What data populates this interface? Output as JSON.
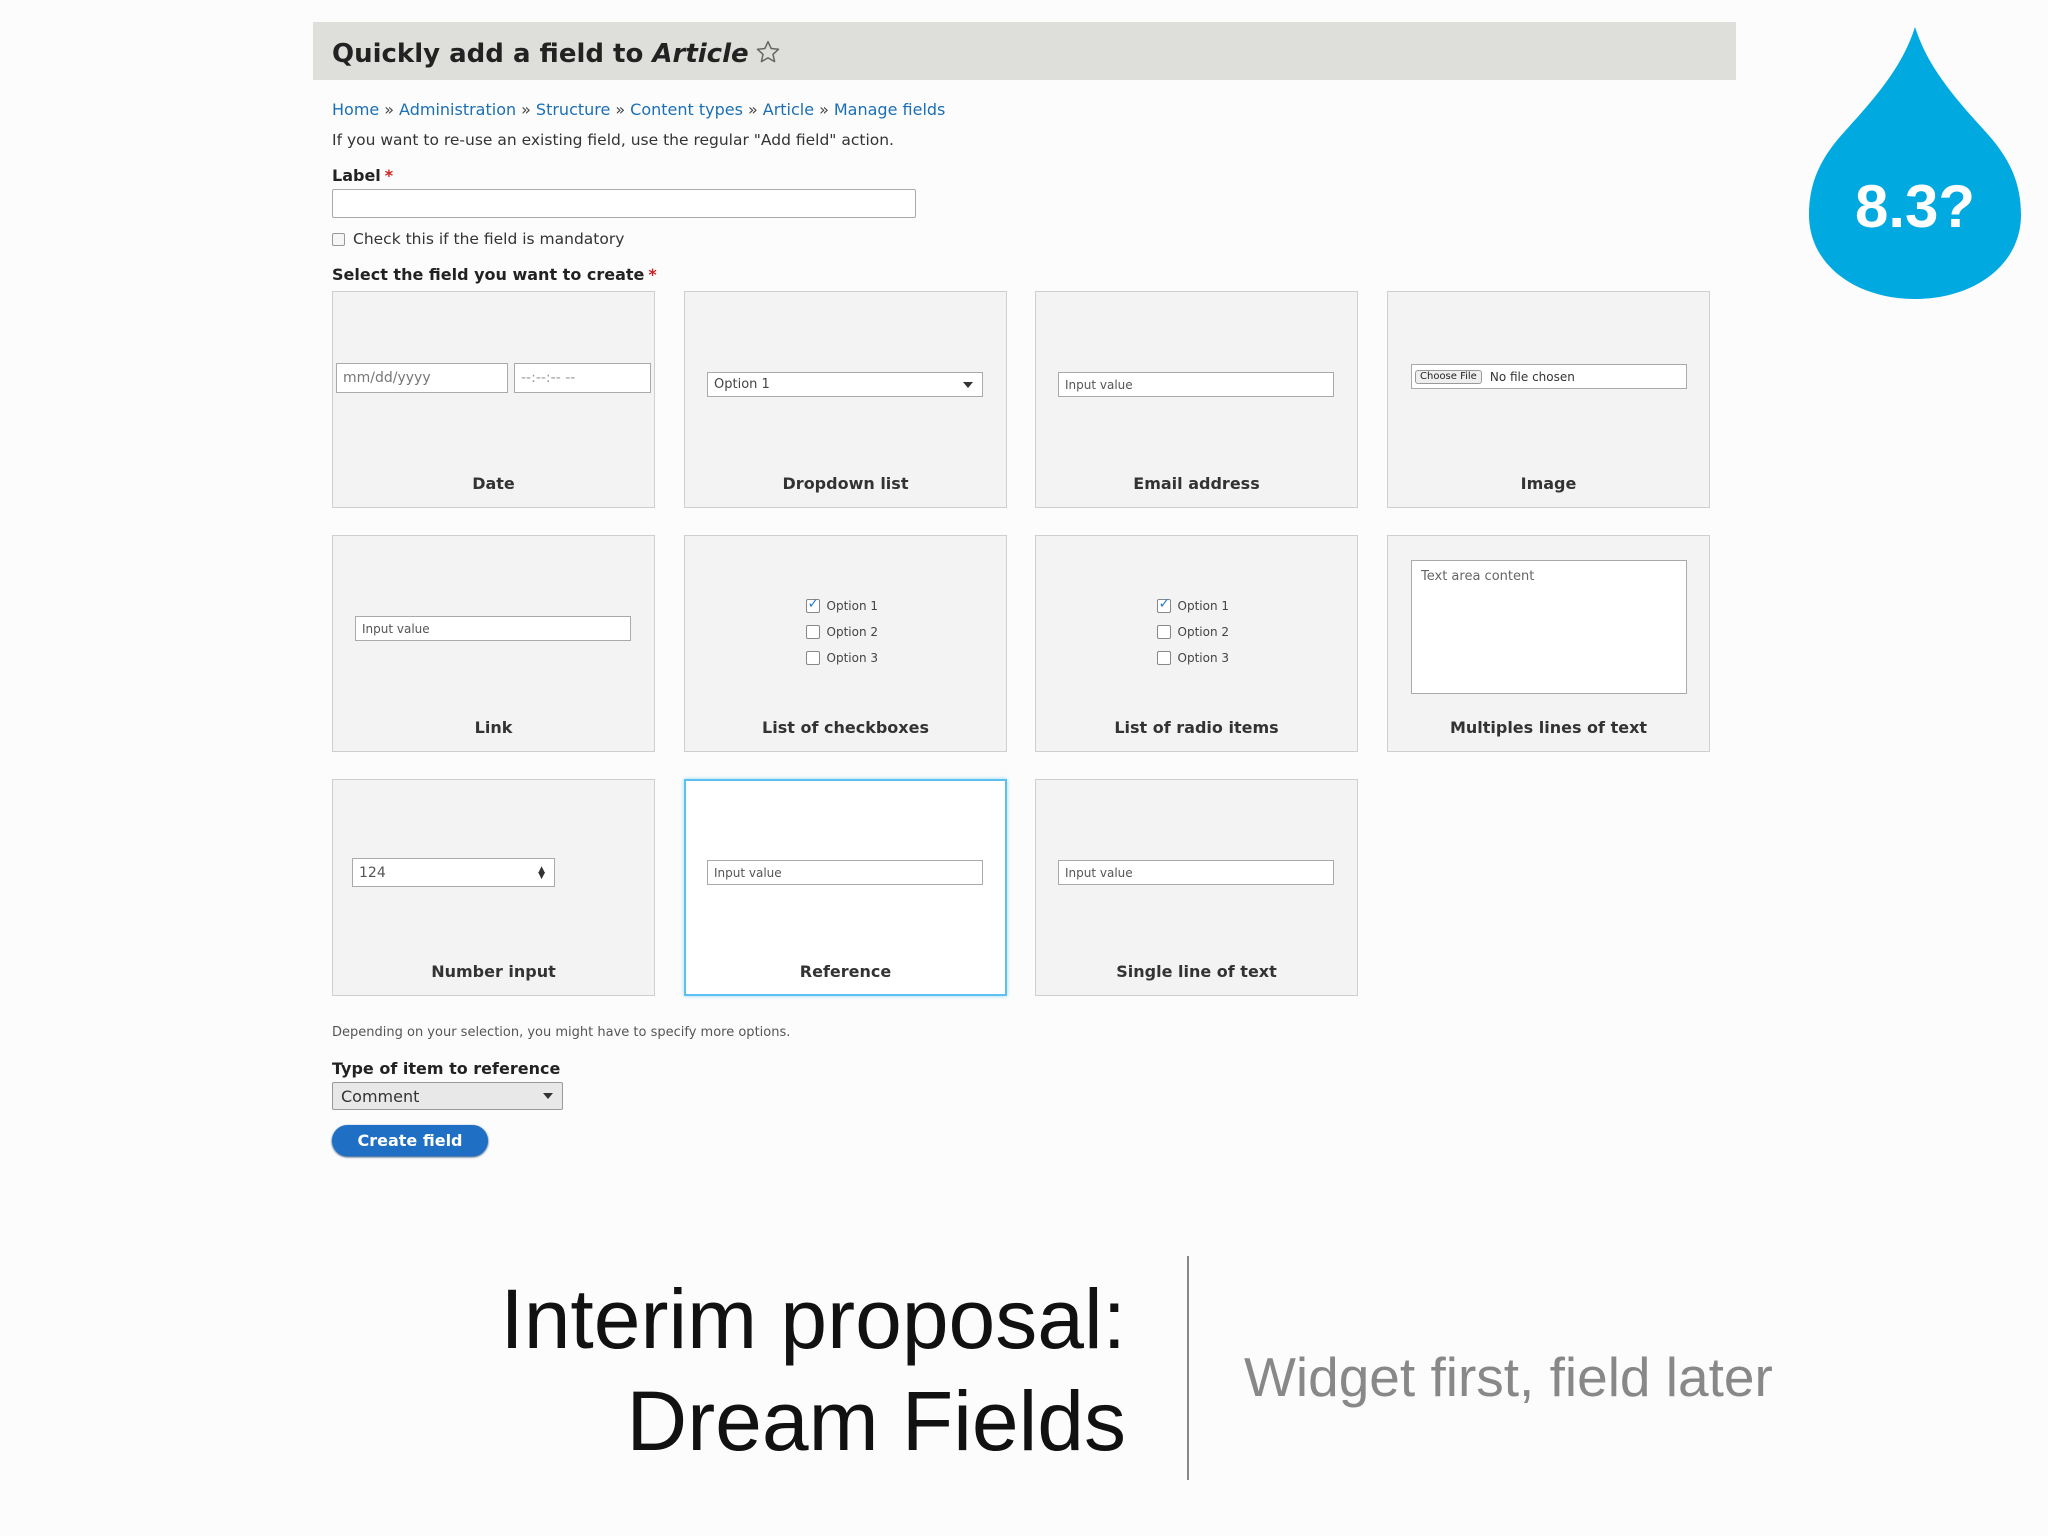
{
  "header": {
    "title_prefix": "Quickly add a field to",
    "title_entity": "Article",
    "star_icon": "star-outline-icon"
  },
  "breadcrumb": [
    "Home",
    "Administration",
    "Structure",
    "Content types",
    "Article",
    "Manage fields"
  ],
  "breadcrumb_separator": "»",
  "help_text": "If you want to re-use an existing field, use the regular \"Add field\" action.",
  "label_field": {
    "label": "Label",
    "required_mark": "*",
    "value": ""
  },
  "mandatory_checkbox": {
    "label": "Check this if the field is mandatory",
    "checked": false
  },
  "select_heading": {
    "label": "Select the field you want to create",
    "required_mark": "*"
  },
  "field_types": {
    "date": {
      "caption": "Date",
      "date_placeholder": "mm/dd/yyyy",
      "time_placeholder": "--:--:-- --"
    },
    "dropdown": {
      "caption": "Dropdown list",
      "value": "Option 1"
    },
    "email": {
      "caption": "Email address",
      "value": "Input value"
    },
    "image": {
      "caption": "Image",
      "button": "Choose File",
      "status": "No file chosen"
    },
    "link": {
      "caption": "Link",
      "value": "Input value"
    },
    "checkboxes": {
      "caption": "List of checkboxes",
      "options": [
        "Option 1",
        "Option 2",
        "Option 3"
      ],
      "checked_index": 0
    },
    "radios": {
      "caption": "List of radio items",
      "options": [
        "Option 1",
        "Option 2",
        "Option 3"
      ],
      "checked_index": 0
    },
    "multiline": {
      "caption": "Multiples lines of text",
      "value": "Text area content"
    },
    "number": {
      "caption": "Number input",
      "value": "124"
    },
    "reference": {
      "caption": "Reference",
      "value": "Input value",
      "selected": true
    },
    "single_line": {
      "caption": "Single line of text",
      "value": "Input value"
    }
  },
  "options_note": "Depending on your selection, you might have to specify more options.",
  "reference_type": {
    "label": "Type of item to reference",
    "value": "Comment"
  },
  "submit_button": "Create field",
  "version_badge": {
    "text": "8.3?",
    "color": "#00a9e0"
  },
  "slide": {
    "title_line1": "Interim proposal:",
    "title_line2": "Dream Fields",
    "subtitle": "Widget first, field later"
  },
  "colors": {
    "link": "#1b6fb5",
    "button": "#1f6fc4",
    "selected_border": "#5cc0f0",
    "required": "#d02020"
  }
}
